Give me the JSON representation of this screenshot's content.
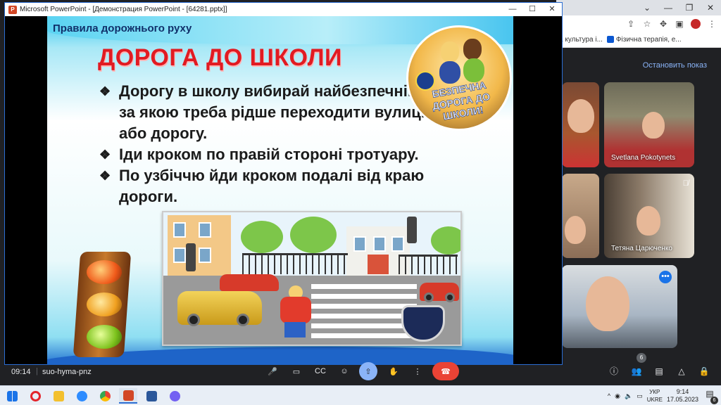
{
  "ppt_window": {
    "title": "Microsoft PowerPoint - [Демонстрация PowerPoint - [64281.pptx]]",
    "controls": {
      "minimize": "—",
      "maximize": "☐",
      "close": "✕"
    }
  },
  "slide": {
    "subtitle": "Правила дорожнього руху",
    "title": "ДОРОГА ДО ШКОЛИ",
    "bullets": [
      {
        "marker": "❖",
        "text": "Дорогу в школу вибирай найбезпечнішу, за якою треба рідше переходити вулицю або дорогу."
      },
      {
        "marker": "❖",
        "text": "Іди кроком по правій стороні тротуару."
      },
      {
        "marker": "❖",
        "text": " По узбіччю йди кроком подалі від краю дороги."
      }
    ],
    "badge_text_line1": "БЕЗПЕЧНА",
    "badge_text_line2": "ДОРОГА ДО ШКОЛИ!"
  },
  "chrome": {
    "bookmarks": [
      "а культура і...",
      "Фізична терапія, е..."
    ],
    "stop_presenting": "Остановить показ",
    "toolbar_icons": [
      "share-icon",
      "star-icon",
      "extensions-icon",
      "sidepanel-icon",
      "profile-icon",
      "menu-icon"
    ]
  },
  "participants": [
    {
      "name": ""
    },
    {
      "name": "Svetlana Pokotynets"
    },
    {
      "name": ""
    },
    {
      "name": "Тетяна Царюченко",
      "muted": true
    },
    {
      "name": "",
      "has_menu": true
    }
  ],
  "meet": {
    "time": "09:14",
    "separator": "|",
    "meeting_code": "suo-hyma-pnz",
    "people_count": "6",
    "controls": [
      "mic-icon",
      "camera-icon",
      "captions-icon",
      "emoji-icon",
      "present-icon",
      "raise-hand-icon",
      "more-icon",
      "leave-call-icon"
    ],
    "right_controls": [
      "info-icon",
      "people-icon",
      "chat-icon",
      "activities-icon",
      "host-controls-icon"
    ]
  },
  "taskbar": {
    "apps": [
      "windows-start-icon",
      "opera-icon",
      "file-explorer-icon",
      "zoom-icon",
      "chrome-icon",
      "powerpoint-icon",
      "word-icon",
      "viber-icon"
    ],
    "lang_line1": "УКР",
    "lang_line2": "UKRE",
    "time": "9:14",
    "date": "17.05.2023",
    "notifications": "6",
    "tray_chevron": "^"
  }
}
